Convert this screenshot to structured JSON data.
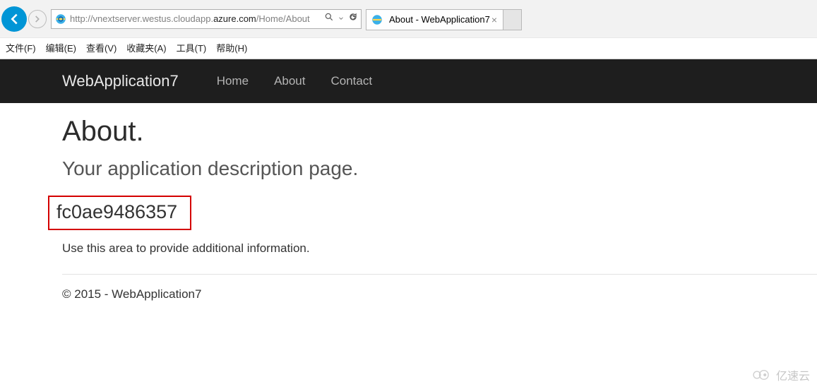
{
  "browser": {
    "url_prefix": "http://vnextserver.westus.cloudapp.",
    "url_domain": "azure.com",
    "url_suffix": "/Home/About",
    "tab_title": "About - WebApplication7",
    "menus": [
      "文件(F)",
      "编辑(E)",
      "查看(V)",
      "收藏夹(A)",
      "工具(T)",
      "帮助(H)"
    ]
  },
  "nav": {
    "brand": "WebApplication7",
    "links": [
      "Home",
      "About",
      "Contact"
    ]
  },
  "page": {
    "title": "About.",
    "subtitle": "Your application description page.",
    "server_id": "fc0ae9486357",
    "info": "Use this area to provide additional information.",
    "footer": "© 2015 - WebApplication7"
  },
  "watermark": "亿速云"
}
